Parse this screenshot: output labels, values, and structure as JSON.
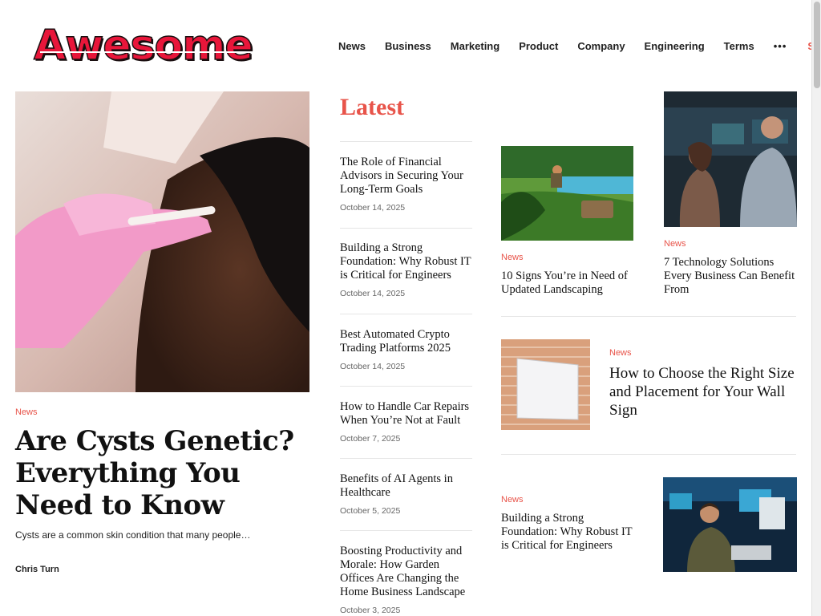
{
  "brand": {
    "logo_text": "Awesome"
  },
  "nav": {
    "items": [
      "News",
      "Business",
      "Marketing",
      "Product",
      "Company",
      "Engineering",
      "Terms"
    ],
    "more": "•••",
    "search": "Search"
  },
  "featured": {
    "category": "News",
    "title": "Are Cysts Genetic? Everything You Need to Know",
    "excerpt": "Cysts are a common skin condition that many people…",
    "author": "Chris Turn"
  },
  "latest": {
    "heading": "Latest",
    "items": [
      {
        "title": "The Role of Financial Advisors in Securing Your Long-Term Goals",
        "date": "October 14, 2025"
      },
      {
        "title": "Building a Strong Foundation: Why Robust IT is Critical for Engineers",
        "date": "October 14, 2025"
      },
      {
        "title": "Best Automated Crypto Trading Platforms 2025",
        "date": "October 14, 2025"
      },
      {
        "title": "How to Handle Car Repairs When You’re Not at Fault",
        "date": "October 7, 2025"
      },
      {
        "title": "Benefits of AI Agents in Healthcare",
        "date": "October 5, 2025"
      },
      {
        "title": "Boosting Productivity and Morale: How Garden Offices Are Changing the Home Business Landscape",
        "date": "October 3, 2025"
      }
    ]
  },
  "cards": {
    "landscaping": {
      "category": "News",
      "title": "10 Signs You’re in Need of Updated Landscaping"
    },
    "technology": {
      "category": "News",
      "title": "7 Technology Solutions Every Business Can Benefit From"
    },
    "wall_sign": {
      "category": "News",
      "title": "How to Choose the Right Size and Placement for Your Wall Sign"
    },
    "it_engineers": {
      "category": "News",
      "title": "Building a Strong Foundation: Why Robust IT is Critical for Engineers"
    }
  },
  "colors": {
    "accent": "#e8544a",
    "text": "#111111",
    "muted": "#666666"
  }
}
